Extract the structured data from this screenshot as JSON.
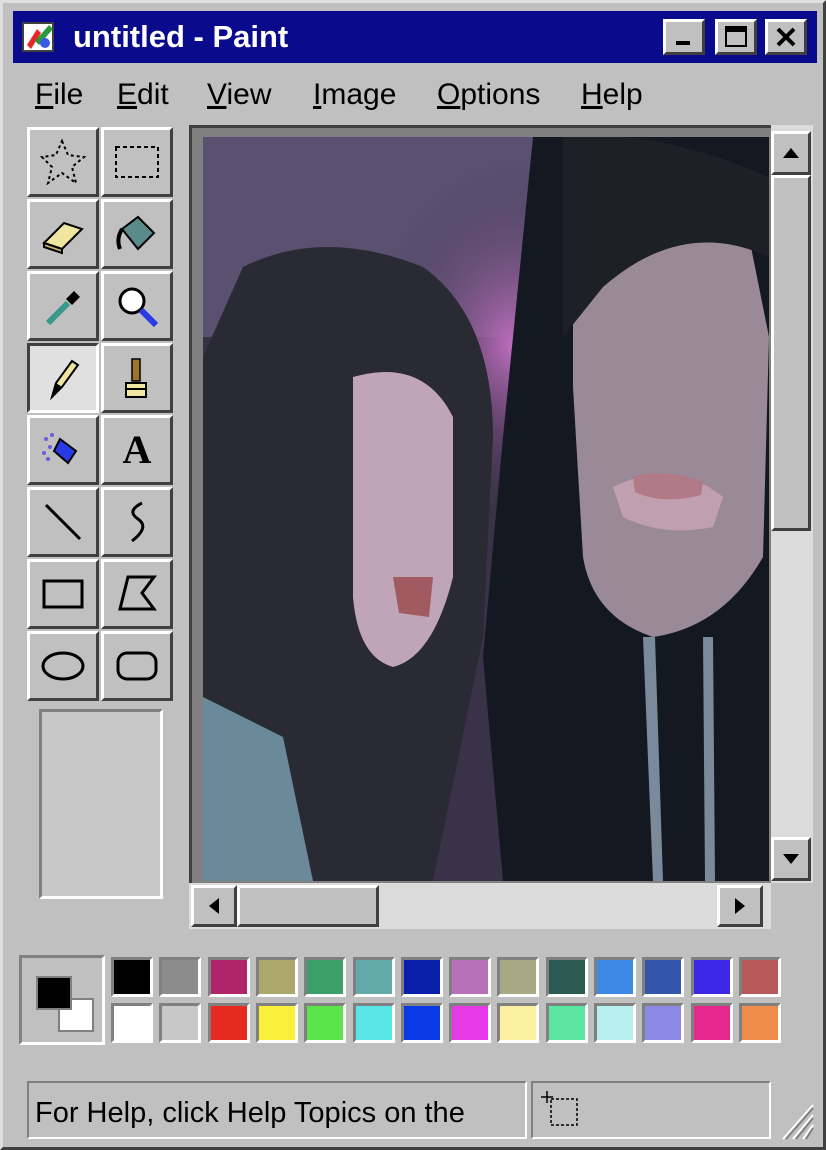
{
  "window": {
    "title": "untitled - Paint",
    "title_bar_color": "#0a0a8c",
    "face_color": "#c0c0c0",
    "controls": [
      "minimize-icon",
      "maximize-icon",
      "close-icon"
    ]
  },
  "menu": [
    {
      "id": "file",
      "first": "F",
      "rest": "ile"
    },
    {
      "id": "edit",
      "first": "E",
      "rest": "dit"
    },
    {
      "id": "view",
      "first": "V",
      "rest": "iew"
    },
    {
      "id": "image",
      "first": "I",
      "rest": "mage"
    },
    {
      "id": "options",
      "first": "O",
      "rest": "ptions"
    },
    {
      "id": "help",
      "first": "H",
      "rest": "elp"
    }
  ],
  "tools": [
    {
      "name": "free-form-select",
      "icon": "free-form-select-icon"
    },
    {
      "name": "select",
      "icon": "rectangle-select-icon"
    },
    {
      "name": "eraser",
      "icon": "eraser-icon"
    },
    {
      "name": "fill-with-color",
      "icon": "paint-bucket-icon"
    },
    {
      "name": "pick-color",
      "icon": "eyedropper-icon"
    },
    {
      "name": "magnifier",
      "icon": "magnifier-icon"
    },
    {
      "name": "pencil",
      "icon": "pencil-icon",
      "active": true
    },
    {
      "name": "brush",
      "icon": "brush-icon"
    },
    {
      "name": "airbrush",
      "icon": "airbrush-icon"
    },
    {
      "name": "text",
      "icon": "text-icon"
    },
    {
      "name": "line",
      "icon": "line-icon"
    },
    {
      "name": "curve",
      "icon": "curve-icon"
    },
    {
      "name": "rectangle",
      "icon": "rectangle-icon"
    },
    {
      "name": "polygon",
      "icon": "polygon-icon"
    },
    {
      "name": "ellipse",
      "icon": "ellipse-icon"
    },
    {
      "name": "rounded-rectangle",
      "icon": "rounded-rectangle-icon"
    }
  ],
  "text_tool_glyph": "A",
  "colors": {
    "foreground": "#000000",
    "background": "#ffffff"
  },
  "palette": {
    "top": [
      "#000000",
      "#8c8c8c",
      "#b0246a",
      "#aaa86a",
      "#3aa068",
      "#64aaaa",
      "#0a20aa",
      "#b870b8",
      "#a8a884",
      "#2a5a52",
      "#3c8ae6",
      "#3456aa",
      "#3c28e6",
      "#b85a5a"
    ],
    "bottom": [
      "#ffffff",
      "#c8c8c8",
      "#e62a20",
      "#faf03a",
      "#5ae64a",
      "#5ae6e6",
      "#0a3ae6",
      "#e63ae6",
      "#faf0a0",
      "#5ae6a0",
      "#b8f0f0",
      "#8c8ae6",
      "#e6288c",
      "#f08c4a"
    ]
  },
  "status": {
    "help_text": "For Help, click Help Topics on the"
  }
}
